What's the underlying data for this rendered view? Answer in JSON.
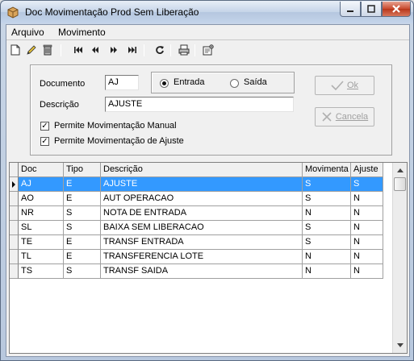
{
  "window": {
    "title": "Doc Movimentação Prod Sem Liberação"
  },
  "menu": [
    {
      "label": "Arquivo"
    },
    {
      "label": "Movimento"
    }
  ],
  "toolbar": {
    "icons": [
      "new-document-icon",
      "edit-pencil-icon",
      "delete-trash-icon",
      "first-record-icon",
      "previous-record-icon",
      "next-record-icon",
      "last-record-icon",
      "refresh-icon",
      "print-icon",
      "properties-icon"
    ]
  },
  "form": {
    "documento_label": "Documento",
    "documento_value": "AJ",
    "descricao_label": "Descrição",
    "descricao_value": "AJUSTE",
    "radio_entrada": "Entrada",
    "radio_saida": "Saída",
    "radio_selected": "Entrada",
    "check_manual": "Permite Movimentação Manual",
    "check_manual_checked": true,
    "check_ajuste": "Permite Movimentação de Ajuste",
    "check_ajuste_checked": true,
    "ok_label": "Ok",
    "cancel_label": "Cancela"
  },
  "grid": {
    "columns": [
      "Doc",
      "Tipo",
      "Descrição",
      "Movimenta",
      "Ajuste"
    ],
    "rows": [
      [
        "AJ",
        "E",
        "AJUSTE",
        "S",
        "S"
      ],
      [
        "AO",
        "E",
        "AUT OPERACAO",
        "S",
        "N"
      ],
      [
        "NR",
        "S",
        "NOTA DE ENTRADA",
        "N",
        "N"
      ],
      [
        "SL",
        "S",
        "BAIXA SEM LIBERACAO",
        "S",
        "N"
      ],
      [
        "TE",
        "E",
        "TRANSF ENTRADA",
        "S",
        "N"
      ],
      [
        "TL",
        "E",
        "TRANSFERENCIA LOTE",
        "N",
        "N"
      ],
      [
        "TS",
        "S",
        "TRANSF SAIDA",
        "N",
        "N"
      ]
    ],
    "selected_row": 0
  },
  "colors": {
    "selection": "#3399ff",
    "close_button": "#c8492d"
  }
}
